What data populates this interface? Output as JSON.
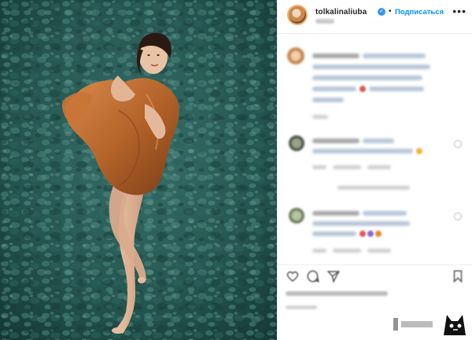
{
  "post": {
    "username": "tolkalinaliuba",
    "verified": true,
    "follow_label": "Подписаться",
    "separator": "•",
    "more_icon": "ellipsis-icon",
    "more_glyph": "•••"
  },
  "media": {
    "description_icon": "photo"
  },
  "colors": {
    "follow_blue": "#0095f6",
    "verified_blue": "#3897f0",
    "text_primary": "#262626",
    "water": "#1f4d4a",
    "fabric": "#b5642a"
  },
  "icons": [
    "heart-icon",
    "comment-icon",
    "share-icon",
    "bookmark-icon",
    "verified-badge-icon",
    "ellipsis-icon"
  ]
}
